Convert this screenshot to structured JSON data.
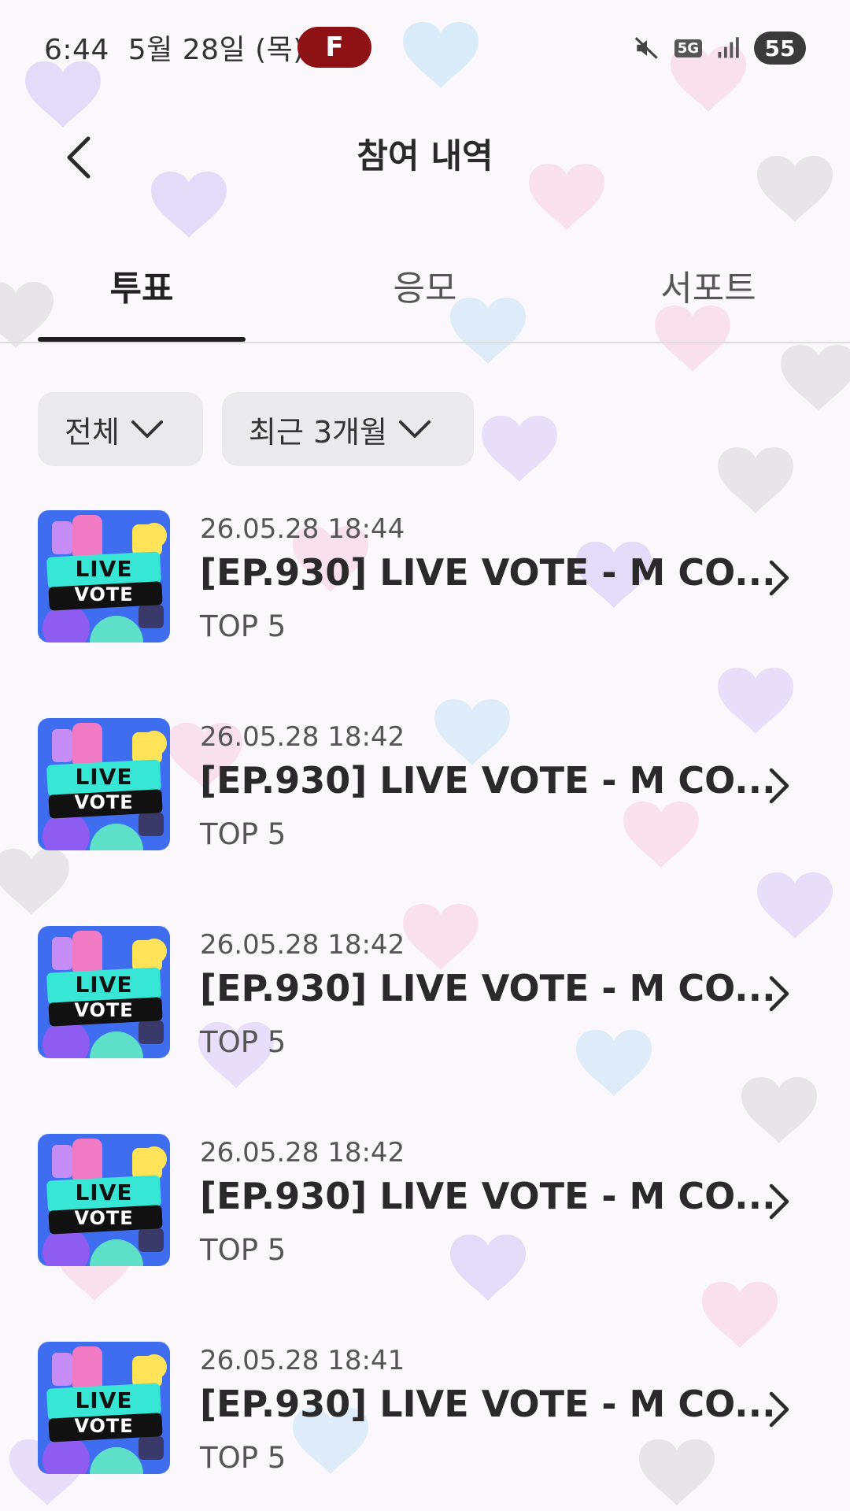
{
  "status_bar": {
    "time": "6:44",
    "date": "5월 28일 (목)",
    "app_badge": "F",
    "network": "5G",
    "battery": "55"
  },
  "header": {
    "title": "참여 내역"
  },
  "tabs": [
    {
      "label": "투표",
      "active": true
    },
    {
      "label": "응모",
      "active": false
    },
    {
      "label": "서포트",
      "active": false
    }
  ],
  "filters": {
    "category": "전체",
    "period": "최근 3개월"
  },
  "items": [
    {
      "date": "26.05.28 18:44",
      "title": "[EP.930] LIVE VOTE - M CO...",
      "rank": "TOP 5",
      "thumb_line1": "LIVE",
      "thumb_line2": "VOTE"
    },
    {
      "date": "26.05.28 18:42",
      "title": "[EP.930] LIVE VOTE - M CO...",
      "rank": "TOP 5",
      "thumb_line1": "LIVE",
      "thumb_line2": "VOTE"
    },
    {
      "date": "26.05.28 18:42",
      "title": "[EP.930] LIVE VOTE - M CO...",
      "rank": "TOP 5",
      "thumb_line1": "LIVE",
      "thumb_line2": "VOTE"
    },
    {
      "date": "26.05.28 18:42",
      "title": "[EP.930] LIVE VOTE - M CO...",
      "rank": "TOP 5",
      "thumb_line1": "LIVE",
      "thumb_line2": "VOTE"
    },
    {
      "date": "26.05.28 18:41",
      "title": "[EP.930] LIVE VOTE - M CO...",
      "rank": "TOP 5",
      "thumb_line1": "LIVE",
      "thumb_line2": "VOTE"
    }
  ],
  "colors": {
    "app_badge_bg": "#8e1116",
    "tab_indicator": "#1e1e1e",
    "thumb_bg": "#3f6df0",
    "thumb_banner": "#38e6d6"
  }
}
